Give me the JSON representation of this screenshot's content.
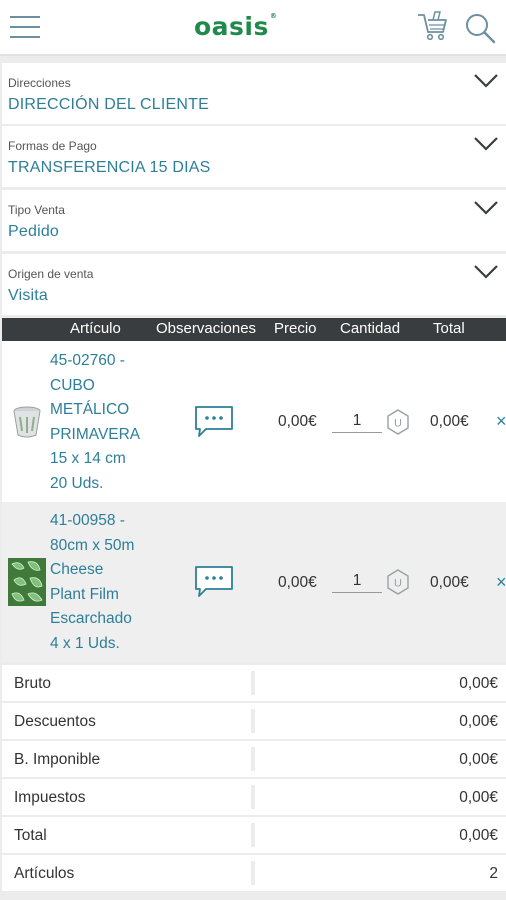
{
  "header": {
    "logo_text": "oasis",
    "logo_mark": "®",
    "brand_color": "#1f8a4c",
    "icons": [
      "menu-icon",
      "cart-icon",
      "search-icon"
    ]
  },
  "fields": [
    {
      "label": "Direcciones",
      "value": "DIRECCIÓN DEL CLIENTE"
    },
    {
      "label": "Formas de Pago",
      "value": "TRANSFERENCIA 15 DIAS"
    },
    {
      "label": "Tipo Venta",
      "value": "Pedido"
    },
    {
      "label": "Origen de venta",
      "value": "Visita"
    }
  ],
  "table": {
    "headers": {
      "article": "Artículo",
      "observations": "Observaciones",
      "price": "Precio",
      "quantity": "Cantidad",
      "total": "Total"
    },
    "rows": [
      {
        "name_lines": [
          "45-02760 -",
          "CUBO",
          "METÁLICO",
          "PRIMAVERA",
          "15 x 14 cm",
          "20 Uds."
        ],
        "price": "0,00€",
        "quantity": "1",
        "unit_badge": "U",
        "total": "0,00€",
        "remove": "×"
      },
      {
        "name_lines": [
          "41-00958 -",
          "80cm x 50m",
          "Cheese",
          "Plant Film",
          "Escarchado",
          "4 x 1 Uds."
        ],
        "price": "0,00€",
        "quantity": "1",
        "unit_badge": "U",
        "total": "0,00€",
        "remove": "×"
      }
    ]
  },
  "summary": [
    {
      "label": "Bruto",
      "value": "0,00€"
    },
    {
      "label": "Descuentos",
      "value": "0,00€"
    },
    {
      "label": "B. Imponible",
      "value": "0,00€"
    },
    {
      "label": "Impuestos",
      "value": "0,00€"
    },
    {
      "label": "Total",
      "value": "0,00€"
    },
    {
      "label": "Artículos",
      "value": "2"
    }
  ],
  "colors": {
    "accent": "#2d7f99",
    "table_header_bg": "#3a3d40"
  }
}
